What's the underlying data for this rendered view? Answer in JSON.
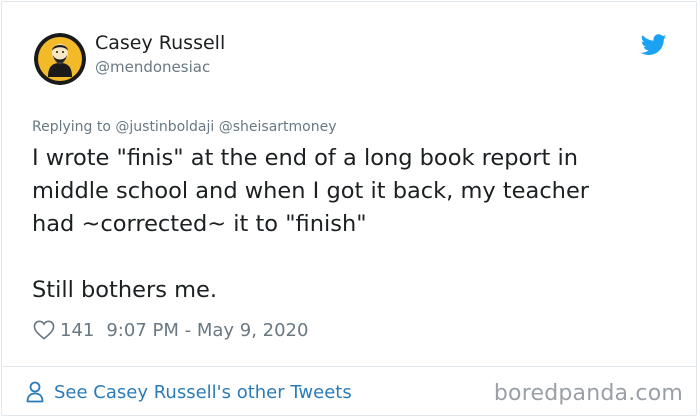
{
  "user": {
    "display_name": "Casey Russell",
    "handle": "@mendonesiac"
  },
  "tweet": {
    "reply_prefix": "Replying to",
    "reply_mentions": [
      "@justinboldaji",
      "@sheisartmoney"
    ],
    "text": "I wrote \"finis\" at the end of a long book report in\nmiddle school and when I got it back, my teacher\nhad ~corrected~ it to \"finish\"\n\nStill bothers me.",
    "likes": "141",
    "timestamp": "9:07 PM - May 9, 2020"
  },
  "footer": {
    "other_tweets_label": "See Casey Russell's other Tweets",
    "watermark": "boredpanda.com"
  },
  "icons": {
    "brand": "twitter-bird-icon",
    "like": "heart-icon",
    "profile": "person-icon"
  },
  "colors": {
    "link_blue": "#2b7bb9",
    "twitter_blue": "#1da1f2",
    "text_primary": "#1c2022",
    "text_secondary": "#697882",
    "border": "#e1e8ed"
  }
}
